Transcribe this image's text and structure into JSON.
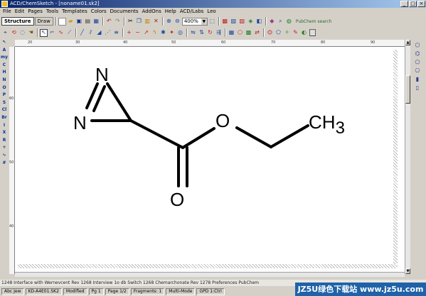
{
  "window": {
    "title": "ACD/ChemSketch - [noname01.sk2]",
    "controls": [
      "_",
      "□",
      "×"
    ]
  },
  "menu": [
    "File",
    "Edit",
    "Pages",
    "Tools",
    "Templates",
    "Colors",
    "Documents",
    "AddOns",
    "Help",
    "ACD/Labs",
    "Leo"
  ],
  "toolbar": {
    "mode_tabs": [
      "Structure",
      "Draw"
    ],
    "zoom": "400%",
    "search_label": "PubChem search"
  },
  "left_tools": [
    "↖",
    "A",
    "my",
    "C",
    "H",
    "N",
    "O",
    "P",
    "S",
    "Cl",
    "Br",
    "I",
    "X",
    "R",
    "+",
    "∿",
    "#"
  ],
  "ruler": {
    "top_ticks": [
      "20",
      "30",
      "40",
      "50",
      "60",
      "70",
      "80",
      "90"
    ],
    "left_ticks": [
      "60",
      "50",
      "40"
    ]
  },
  "molecule": {
    "atom_N1": "N",
    "atom_N2": "N",
    "atom_O1": "O",
    "atom_O2": "O",
    "group_CH": "CH",
    "group_sub": "3"
  },
  "status": {
    "message": "1248 Interface with Wernevcent Rev 1268 Interview 1o db Switch 1268 Chemarchonate Rev 1278 Preferences PubChem",
    "panels": [
      "Abc Jew",
      "KD-A4E01.SK2",
      "Modified",
      "Pg 1",
      "Page 1/2",
      "Fragments: 1",
      "Multi-Mode",
      "GPD 1:Ctrl"
    ]
  },
  "watermark": "JZ5U绿色下载站 www.jz5u.com",
  "colors": {
    "chrome": "#d4d0c8",
    "titlebar": "#0a246a",
    "watermark_bg": "#1f62a8"
  }
}
